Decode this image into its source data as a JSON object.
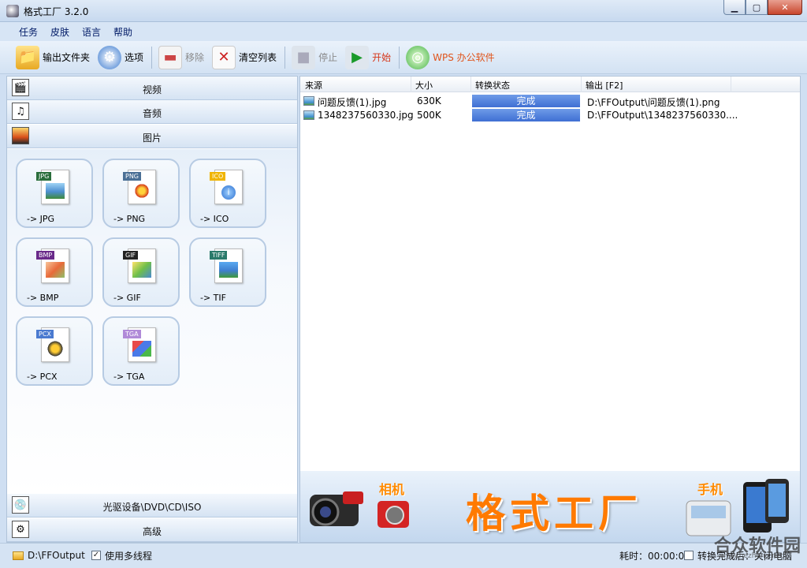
{
  "window": {
    "title": "格式工厂 3.2.0",
    "minimize": "▁",
    "maximize": "▢",
    "close": "✕"
  },
  "menu": [
    "任务",
    "皮肤",
    "语言",
    "帮助"
  ],
  "toolbar": {
    "output_folder": "输出文件夹",
    "options": "选项",
    "remove": "移除",
    "clear_list": "清空列表",
    "stop": "停止",
    "start": "开始",
    "wps": "WPS 办公软件"
  },
  "categories": {
    "video": "视频",
    "audio": "音频",
    "image": "图片",
    "rom": "光驱设备\\DVD\\CD\\ISO",
    "advanced": "高级"
  },
  "formats": [
    {
      "tag": "JPG",
      "label": "-> JPG",
      "color": "#2a6e3c"
    },
    {
      "tag": "PNG",
      "label": "-> PNG",
      "color": "#4a6f95"
    },
    {
      "tag": "ICO",
      "label": "-> ICO",
      "color": "#f0b400"
    },
    {
      "tag": "BMP",
      "label": "-> BMP",
      "color": "#6a2a8a"
    },
    {
      "tag": "GIF",
      "label": "-> GIF",
      "color": "#222222"
    },
    {
      "tag": "TIFF",
      "label": "-> TIF",
      "color": "#2a7a6a"
    },
    {
      "tag": "PCX",
      "label": "-> PCX",
      "color": "#4a7ad0"
    },
    {
      "tag": "TGA",
      "label": "-> TGA",
      "color": "#b08ad8"
    }
  ],
  "table": {
    "headers": [
      "来源",
      "大小",
      "转换状态",
      "输出 [F2]"
    ],
    "rows": [
      {
        "source": "问题反馈(1).jpg",
        "size": "630K",
        "status": "完成",
        "output": "D:\\FFOutput\\问题反馈(1).png"
      },
      {
        "source": "1348237560330.jpg",
        "size": "500K",
        "status": "完成",
        "output": "D:\\FFOutput\\1348237560330...."
      }
    ]
  },
  "banner": {
    "title": "格式工厂",
    "camera": "相机",
    "phone": "手机"
  },
  "statusbar": {
    "output_path": "D:\\FFOutput",
    "multithread": "使用多线程",
    "elapsed": "耗时：00:00:01",
    "after_done": "转换完成后：关闭电脑"
  },
  "watermark": {
    "main": "合众软件园",
    "sub": "www.hezhong.net"
  }
}
